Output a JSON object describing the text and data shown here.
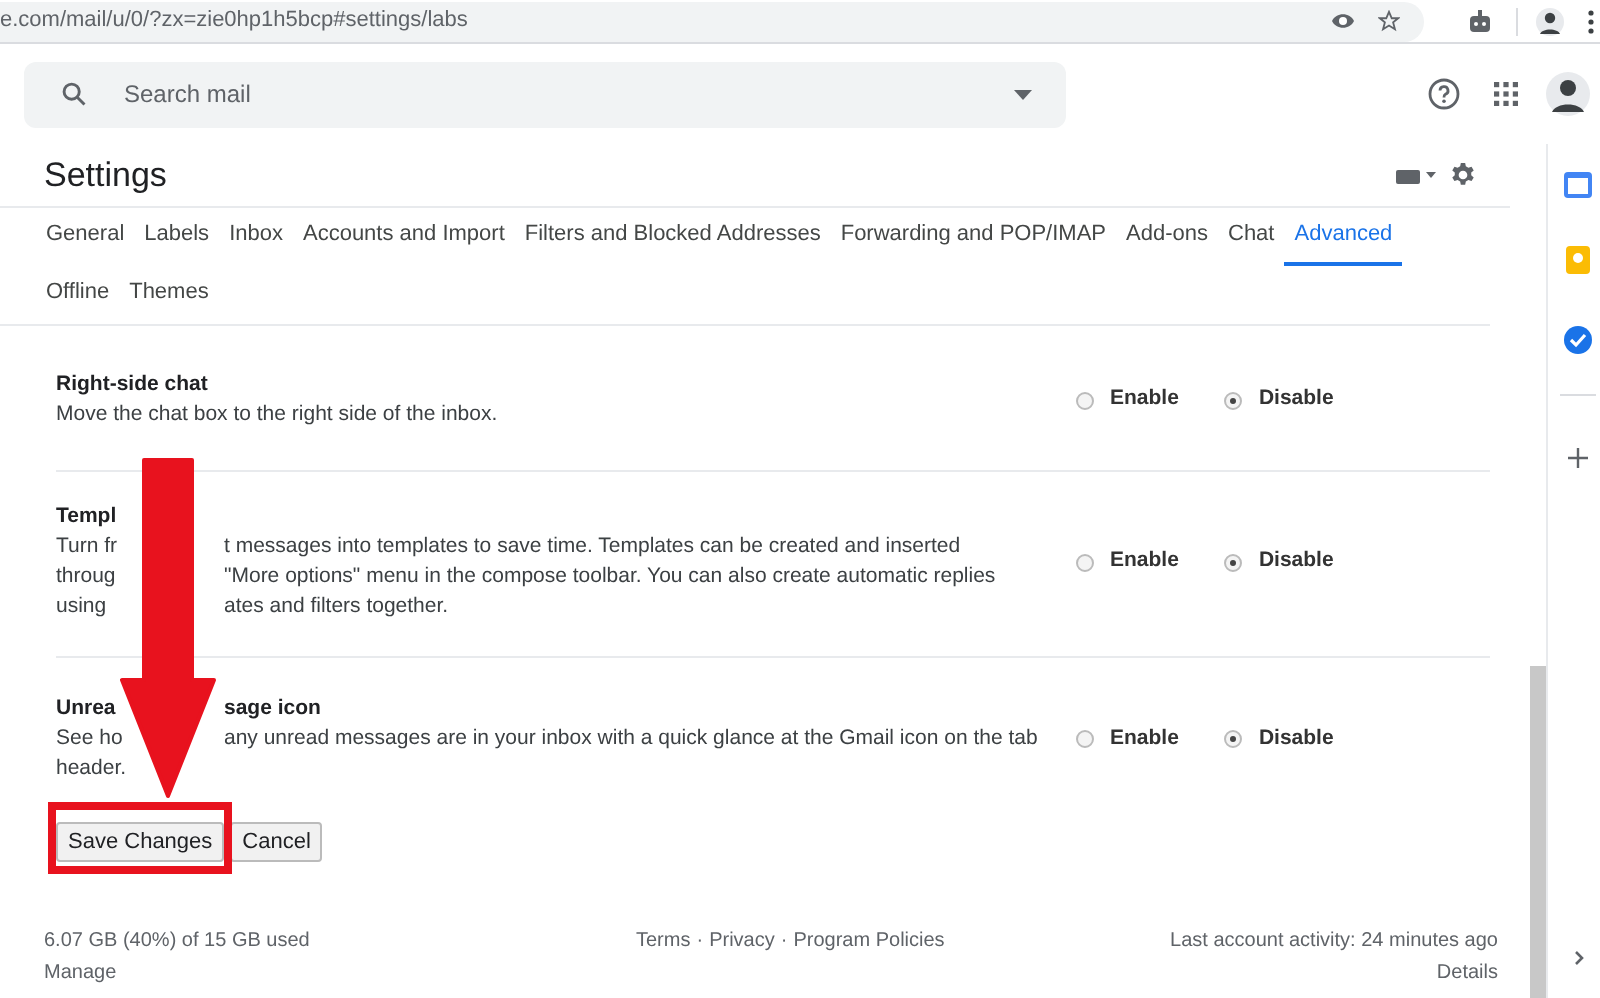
{
  "browser": {
    "url": "e.com/mail/u/0/?zx=zie0hp1h5bcp#settings/labs"
  },
  "search": {
    "placeholder": "Search mail"
  },
  "title": "Settings",
  "tabs": [
    {
      "label": "General",
      "selected": false
    },
    {
      "label": "Labels",
      "selected": false
    },
    {
      "label": "Inbox",
      "selected": false
    },
    {
      "label": "Accounts and Import",
      "selected": false
    },
    {
      "label": "Filters and Blocked Addresses",
      "selected": false
    },
    {
      "label": "Forwarding and POP/IMAP",
      "selected": false
    },
    {
      "label": "Add-ons",
      "selected": false
    },
    {
      "label": "Chat",
      "selected": false
    },
    {
      "label": "Advanced",
      "selected": true
    },
    {
      "label": "Offline",
      "selected": false
    },
    {
      "label": "Themes",
      "selected": false
    }
  ],
  "settings": [
    {
      "title": [
        "Right-side chat"
      ],
      "description": [
        [
          "Move the chat box to the right side of the inbox."
        ]
      ],
      "options": [
        {
          "label": "Enable",
          "selected": false
        },
        {
          "label": "Disable",
          "selected": true
        }
      ]
    },
    {
      "title": [
        "Templ"
      ],
      "description": [
        [
          "Turn fr",
          "t messages into templates to save time. Templates can be created and inserted"
        ],
        [
          "throug",
          "\"More options\" menu in the compose toolbar. You can also create automatic replies"
        ],
        [
          "using",
          "ates and filters together."
        ]
      ],
      "options": [
        {
          "label": "Enable",
          "selected": false
        },
        {
          "label": "Disable",
          "selected": true
        }
      ]
    },
    {
      "title": [
        "Unrea",
        "sage icon"
      ],
      "description": [
        [
          "See ho",
          "any unread messages are in your inbox with a quick glance at the Gmail icon on the tab"
        ],
        [
          "header."
        ]
      ],
      "options": [
        {
          "label": "Enable",
          "selected": false
        },
        {
          "label": "Disable",
          "selected": true
        }
      ]
    }
  ],
  "buttons": {
    "save": "Save Changes",
    "cancel": "Cancel"
  },
  "footer": {
    "storage": "6.07 GB (40%) of 15 GB used",
    "manage": "Manage",
    "links": [
      "Terms",
      "Privacy",
      "Program Policies"
    ],
    "separator": "·",
    "activity": "Last account activity: 24 minutes ago",
    "details": "Details"
  }
}
